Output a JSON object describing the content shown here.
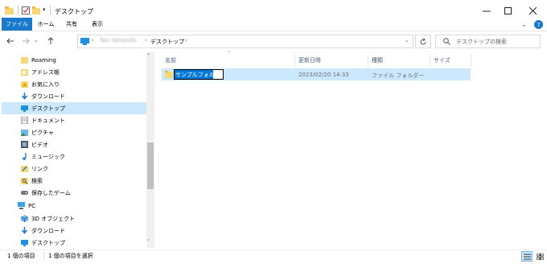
{
  "window": {
    "title": "デスクトップ"
  },
  "ribbon": {
    "tabs": [
      "ファイル",
      "ホーム",
      "共有",
      "表示"
    ]
  },
  "address": {
    "crumbs": [
      "Taro Yamamoto",
      "デスクトップ"
    ],
    "search_placeholder": "デスクトップの検索"
  },
  "nav": {
    "items": [
      {
        "label": "Roaming",
        "icon": "folder-icon"
      },
      {
        "label": "アドレス帳",
        "icon": "address-book-icon"
      },
      {
        "label": "お気に入り",
        "icon": "star-icon"
      },
      {
        "label": "ダウンロード",
        "icon": "download-icon"
      },
      {
        "label": "デスクトップ",
        "icon": "desktop-icon",
        "selected": true
      },
      {
        "label": "ドキュメント",
        "icon": "document-icon"
      },
      {
        "label": "ピクチャ",
        "icon": "pictures-icon"
      },
      {
        "label": "ビデオ",
        "icon": "video-icon"
      },
      {
        "label": "ミュージック",
        "icon": "music-icon"
      },
      {
        "label": "リンク",
        "icon": "link-icon"
      },
      {
        "label": "検索",
        "icon": "search-icon"
      },
      {
        "label": "保存したゲーム",
        "icon": "games-icon"
      },
      {
        "label": "PC",
        "icon": "pc-icon"
      },
      {
        "label": "3D オブジェクト",
        "icon": "3d-objects-icon"
      },
      {
        "label": "ダウンロード",
        "icon": "download-icon"
      },
      {
        "label": "デスクトップ",
        "icon": "desktop-icon"
      }
    ]
  },
  "columns": {
    "name": "名前",
    "modified": "更新日時",
    "type": "種類",
    "size": "サイズ"
  },
  "files": [
    {
      "name": "サンプルフォルダ",
      "modified": "2023/02/20 14:33",
      "type": "ファイル フォルダー",
      "size": ""
    }
  ],
  "status": {
    "count": "1 個の項目",
    "selected": "1 個の項目を選択"
  },
  "colors": {
    "accent": "#1979ca",
    "selection": "#cce8ff",
    "folder": "#f8d775"
  }
}
